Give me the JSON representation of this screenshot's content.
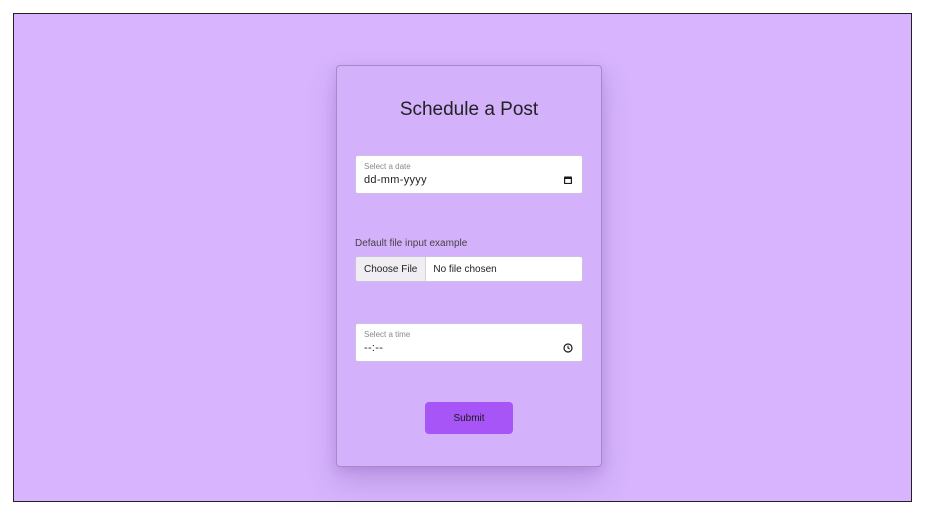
{
  "form": {
    "title": "Schedule a Post",
    "date_field": {
      "label": "Select a date",
      "value": "dd-mm-yyyy",
      "icon": "calendar-icon"
    },
    "file_field": {
      "label": "Default file input example",
      "button_label": "Choose File",
      "status": "No file chosen"
    },
    "time_field": {
      "label": "Select a time",
      "value": "--:--",
      "icon": "clock-icon"
    },
    "submit_label": "Submit"
  },
  "colors": {
    "background": "#d7b4fd",
    "card": "#d4b1fb",
    "accent": "#a855f7"
  }
}
